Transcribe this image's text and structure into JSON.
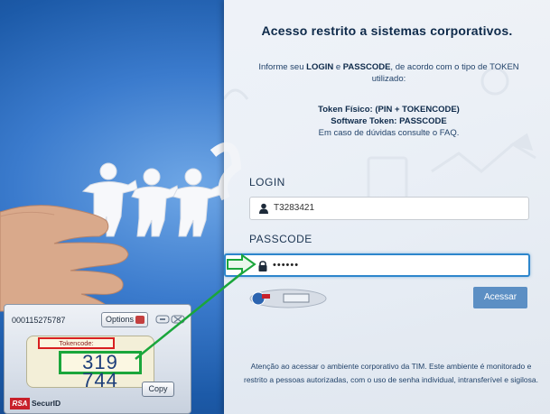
{
  "panel": {
    "title": "Acesso restrito a sistemas corporativos.",
    "info_prefix": "Informe seu ",
    "info_login": "LOGIN",
    "info_and": " e ",
    "info_passcode": "PASSCODE",
    "info_suffix": ", de acordo com o tipo de TOKEN utilizado:",
    "token_physical": "Token Físico: (PIN + TOKENCODE)",
    "token_software": "Software Token: PASSCODE",
    "faq": "Em caso de dúvidas consulte o FAQ.",
    "login_label": "LOGIN",
    "login_value": "T3283421",
    "passcode_label": "PASSCODE",
    "passcode_value": "••••••",
    "submit_label": "Acessar",
    "notice": "Atenção ao acessar o ambiente corporativo da TIM. Este ambiente é monitorado e restrito a pessoas autorizadas, com o uso de senha individual, intransferível e sigilosa."
  },
  "securid": {
    "serial": "000115275787",
    "options_label": "Options",
    "tokencode_label": "Tokencode:",
    "tokencode": "319 744",
    "copy_label": "Copy",
    "brand_rsa": "RSA",
    "brand_name": "SecurID"
  },
  "colors": {
    "highlight": "#1aa63b",
    "arrow": "#1aa63b",
    "button": "#5c8fc4",
    "tokencode_border": "#d82020"
  },
  "icons": {
    "login": "user-icon",
    "passcode": "lock-icon"
  }
}
